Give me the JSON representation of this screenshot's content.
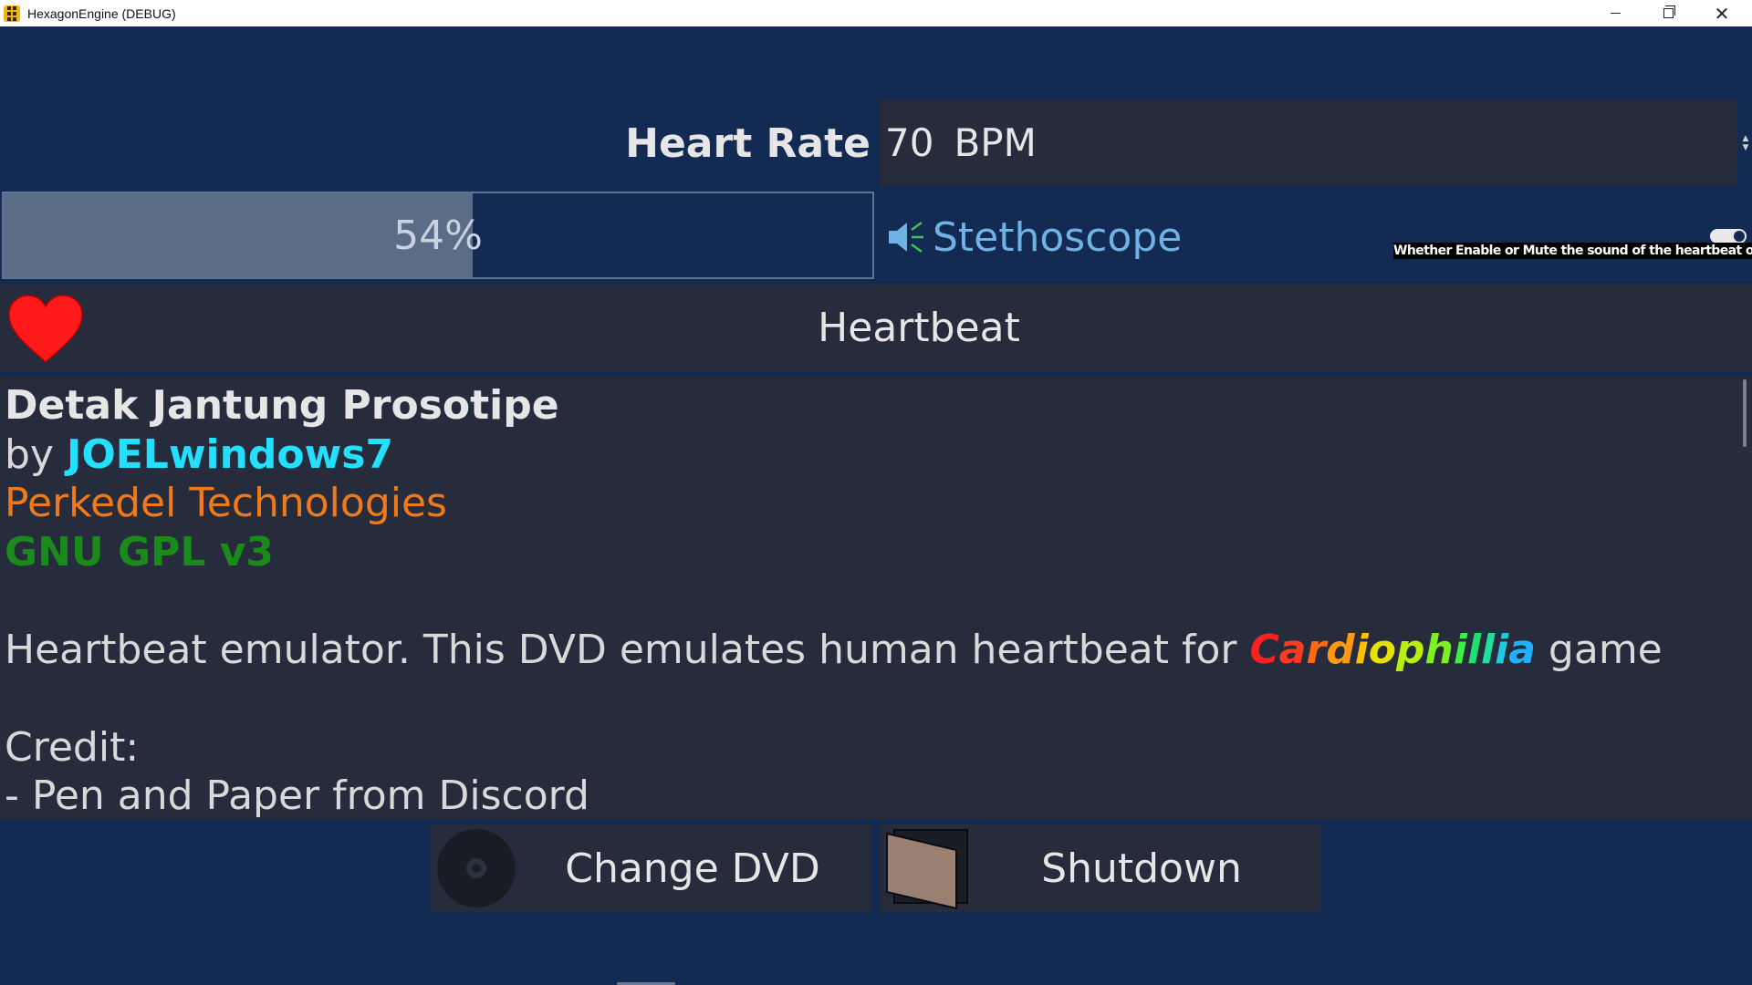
{
  "window": {
    "title": "HexagonEngine (DEBUG)",
    "controls": [
      "minimize-icon",
      "maximize-icon",
      "close-icon"
    ],
    "close_glyph": "✕"
  },
  "heart_rate": {
    "label": "Heart Rate",
    "value": "70",
    "unit": "BPM",
    "spin_up": "▲",
    "spin_down": "▼"
  },
  "progress": {
    "percent": 54,
    "text": "54%"
  },
  "stethoscope": {
    "label": "Stethoscope",
    "enabled": true,
    "tooltip": "Whether Enable or Mute the sound of the heartbeat organ",
    "icon": "speaker-icon"
  },
  "heartbeat_button": {
    "label": "Heartbeat",
    "icon": "heart-icon"
  },
  "info": {
    "title": "Detak Jantung Prosotipe",
    "by_prefix": "by ",
    "author": "JOELwindows7",
    "company": "Perkedel Technologies",
    "license": "GNU GPL v3",
    "description_before": "Heartbeat emulator. This DVD emulates human heartbeat for ",
    "game_name": "Cardiophillia",
    "description_after": " game",
    "credit_heading": "Credit:",
    "credit_line": "- Pen and Paper from Discord"
  },
  "buttons": {
    "change_dvd": "Change DVD",
    "shutdown": "Shutdown"
  },
  "colors": {
    "background": "#132a52",
    "panel": "#262c3c",
    "author": "#24e0ff",
    "company": "#f07a1a",
    "license": "#1a8a1a",
    "stethoscope": "#6fb2e3",
    "heart": "#ff1a1a",
    "rainbow": [
      "#ff2020",
      "#ff3a20",
      "#ff6a10",
      "#ff9a10",
      "#ffc000",
      "#e8e000",
      "#b8ef10",
      "#7ef020",
      "#3cf040",
      "#20e070",
      "#20e0a0",
      "#20c8e0",
      "#20b0ff"
    ]
  }
}
